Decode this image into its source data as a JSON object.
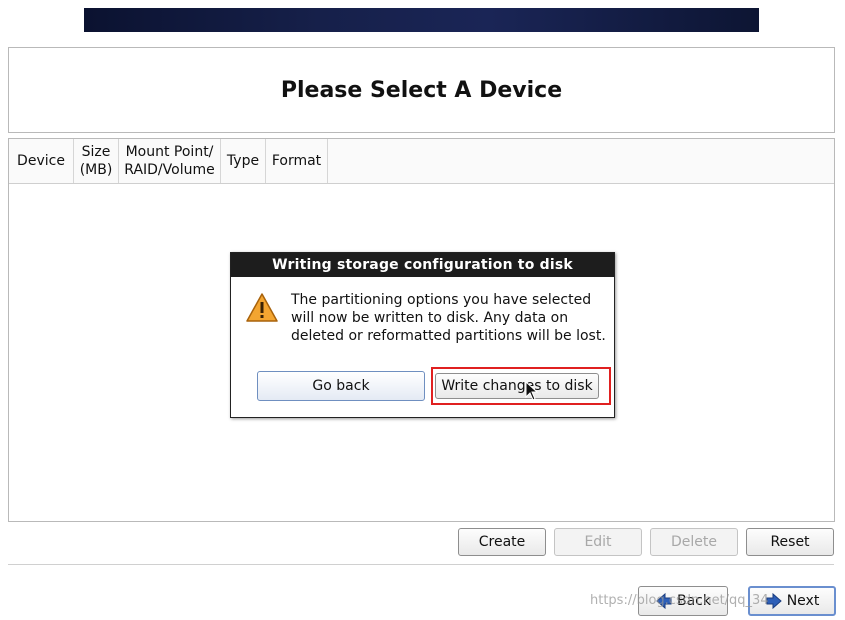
{
  "page": {
    "title": "Please Select A Device"
  },
  "table": {
    "columns": [
      {
        "line1": "Device",
        "line2": ""
      },
      {
        "line1": "Size",
        "line2": "(MB)"
      },
      {
        "line1": "Mount Point/",
        "line2": "RAID/Volume"
      },
      {
        "line1": "Type",
        "line2": ""
      },
      {
        "line1": "Format",
        "line2": ""
      }
    ],
    "rows": []
  },
  "dialog": {
    "title": "Writing storage configuration to disk",
    "message": "The partitioning options you have selected will now be written to disk.  Any data on deleted or reformatted partitions will be lost.",
    "go_back_label": "Go back",
    "write_label": "Write changes to disk",
    "icon": "warning-icon"
  },
  "actions": {
    "create": "Create",
    "edit": "Edit",
    "delete": "Delete",
    "reset": "Reset"
  },
  "nav": {
    "back": "Back",
    "next": "Next"
  },
  "watermark": "https://blog.csdn.net/qq_34"
}
